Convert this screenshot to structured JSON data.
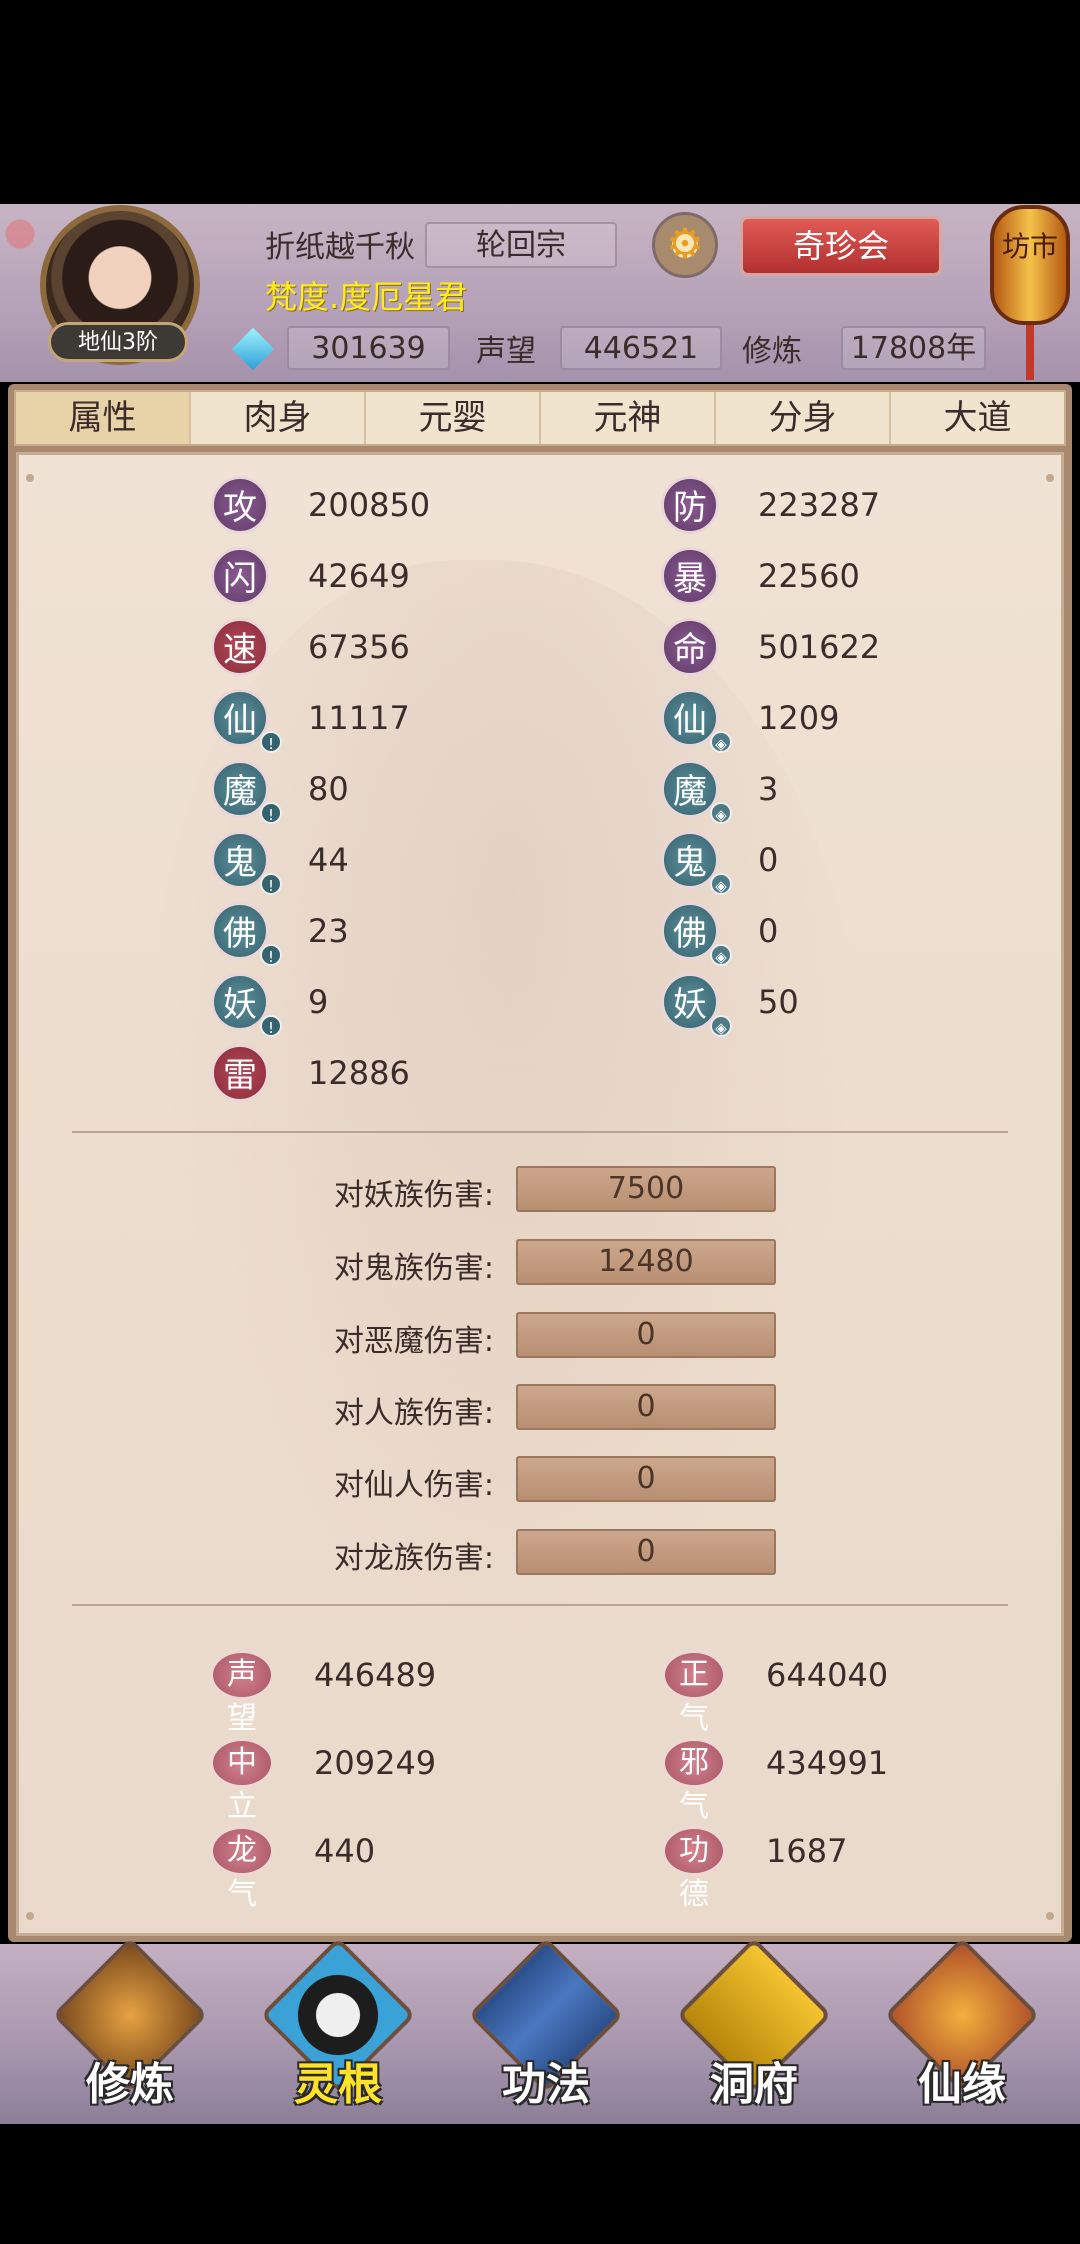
{
  "header": {
    "player_name": "折纸越千秋",
    "sect": "轮回宗",
    "title": "梵度.度厄星君",
    "realm": "地仙3阶",
    "shop_button": "奇珍会",
    "market_sign": "坊市",
    "spirit_stones": "301639",
    "fame_label": "声望",
    "fame_value": "446521",
    "cultivation_label": "修炼",
    "cultivation_value": "17808年"
  },
  "tabs": [
    "属性",
    "肉身",
    "元婴",
    "元神",
    "分身",
    "大道"
  ],
  "active_tab": "属性",
  "stats_left": [
    {
      "label": "攻",
      "value": "200850"
    },
    {
      "label": "闪",
      "value": "42649"
    },
    {
      "label": "速",
      "value": "67356"
    },
    {
      "label": "仙",
      "value": "11117"
    },
    {
      "label": "魔",
      "value": "80"
    },
    {
      "label": "鬼",
      "value": "44"
    },
    {
      "label": "佛",
      "value": "23"
    },
    {
      "label": "妖",
      "value": "9"
    },
    {
      "label": "雷",
      "value": "12886"
    }
  ],
  "stats_right": [
    {
      "label": "防",
      "value": "223287"
    },
    {
      "label": "暴",
      "value": "22560"
    },
    {
      "label": "命",
      "value": "501622"
    },
    {
      "label": "仙",
      "value": "1209"
    },
    {
      "label": "魔",
      "value": "3"
    },
    {
      "label": "鬼",
      "value": "0"
    },
    {
      "label": "佛",
      "value": "0"
    },
    {
      "label": "妖",
      "value": "50"
    }
  ],
  "damage": [
    {
      "label": "对妖族伤害:",
      "value": "7500"
    },
    {
      "label": "对鬼族伤害:",
      "value": "12480"
    },
    {
      "label": "对恶魔伤害:",
      "value": "0"
    },
    {
      "label": "对人族伤害:",
      "value": "0"
    },
    {
      "label": "对仙人伤害:",
      "value": "0"
    },
    {
      "label": "对龙族伤害:",
      "value": "0"
    }
  ],
  "morality": [
    {
      "label": "声望",
      "value": "446489"
    },
    {
      "label": "正气",
      "value": "644040"
    },
    {
      "label": "中立",
      "value": "209249"
    },
    {
      "label": "邪气",
      "value": "434991"
    },
    {
      "label": "龙气",
      "value": "440"
    },
    {
      "label": "功德",
      "value": "1687"
    }
  ],
  "bottom_nav": [
    "修炼",
    "灵根",
    "功法",
    "洞府",
    "仙缘"
  ],
  "active_nav": "灵根",
  "colors": {
    "accent_gold": "#ffeb1f",
    "shop_red": "#c93f3c",
    "panel_bg": "#ecdccc"
  }
}
